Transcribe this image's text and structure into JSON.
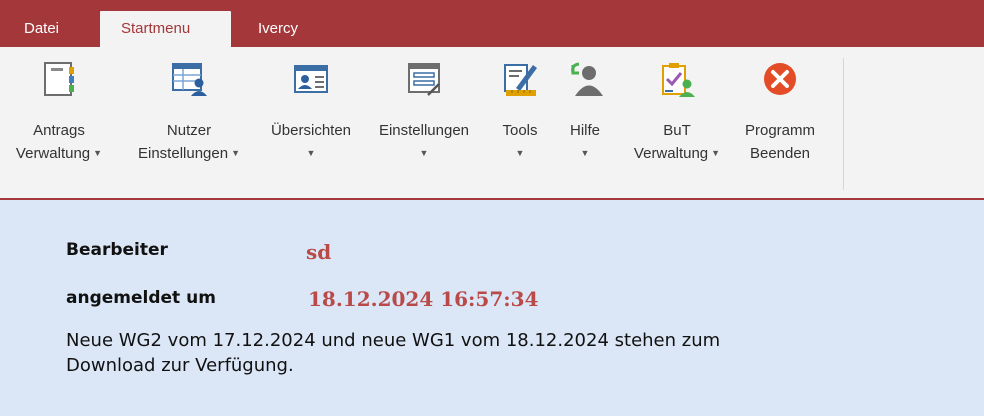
{
  "tabs": [
    {
      "label": "Datei"
    },
    {
      "label": "Startmenu"
    },
    {
      "label": "Ivercy"
    }
  ],
  "ribbon": {
    "buttons": [
      {
        "line1": "Antrags",
        "line2": "Verwaltung",
        "icon": "notebook-icon"
      },
      {
        "line1": "Nutzer",
        "line2": "Einstellungen",
        "icon": "user-table-icon"
      },
      {
        "line1": "Übersichten",
        "line2": "",
        "icon": "contact-card-icon"
      },
      {
        "line1": "Einstellungen",
        "line2": "",
        "icon": "settings-form-icon"
      },
      {
        "line1": "Tools",
        "line2": "",
        "icon": "ruler-pencil-icon"
      },
      {
        "line1": "Hilfe",
        "line2": "",
        "icon": "help-user-icon"
      },
      {
        "line1": "BuT",
        "line2": "Verwaltung",
        "icon": "clipboard-user-icon"
      },
      {
        "line1": "Programm",
        "line2": "Beenden",
        "icon": "close-circle-icon"
      }
    ]
  },
  "content": {
    "editor_label": "Bearbeiter",
    "editor_value": "sd",
    "login_label": "angemeldet um",
    "login_value": "18.12.2024 16:57:34",
    "message_line1": "Neue WG2 vom 17.12.2024 und neue WG1 vom 18.12.2024 stehen zum",
    "message_line2": "Download zur Verfügung."
  },
  "colors": {
    "accent": "#a4373a",
    "ribbon_bg": "#f3f3f3",
    "content_bg": "#dbe7f7",
    "value_red": "#b94a48"
  }
}
